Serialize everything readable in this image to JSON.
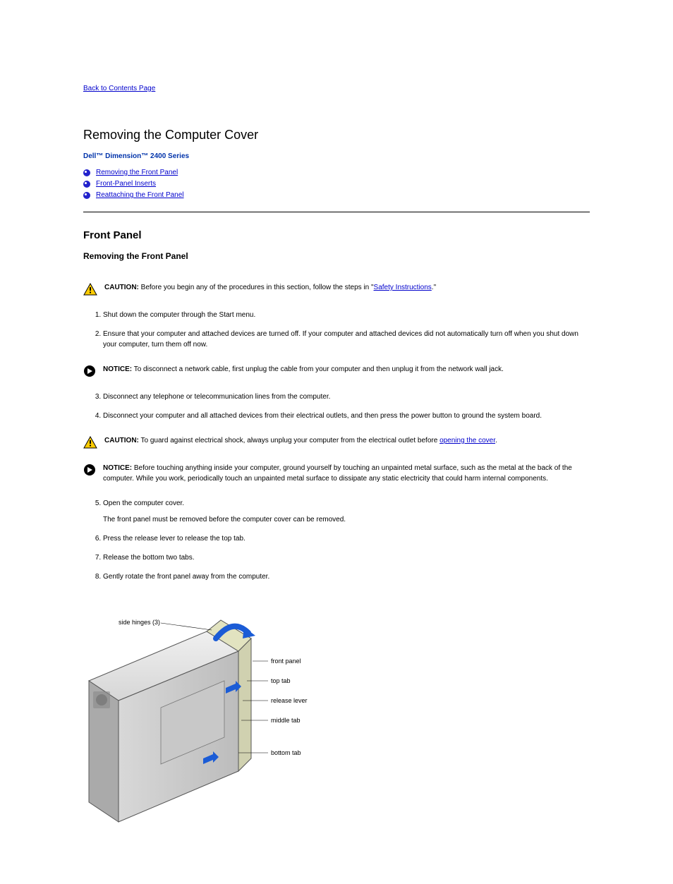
{
  "nav": {
    "back": "Back to Contents Page"
  },
  "header": {
    "title": "Removing the Computer Cover",
    "subtitle": "Dell™ Dimension™ 2400 Series"
  },
  "toc": [
    {
      "label": "Removing the Front Panel"
    },
    {
      "label": "Front-Panel Inserts"
    },
    {
      "label": "Reattaching the Front Panel"
    }
  ],
  "section": {
    "title": "Front Panel",
    "subsectionTitle": "Removing the Front Panel"
  },
  "callouts": {
    "caution1": {
      "label": "CAUTION:",
      "text": "Before you begin any of the procedures in this section, follow the steps in \"",
      "link": "Safety Instructions",
      "after": ".\""
    },
    "notice1": {
      "label": "NOTICE:",
      "text": "To disconnect a network cable, first unplug the cable from your computer and then unplug it from the network wall jack."
    },
    "caution2": {
      "label": "CAUTION:",
      "text": "To guard against electrical shock, always unplug your computer from the electrical outlet before ",
      "link": "opening the cover",
      "after": "."
    },
    "notice2": {
      "label": "NOTICE:",
      "text": "Before touching anything inside your computer, ground yourself by touching an unpainted metal surface, such as the metal at the back of the computer. While you work, periodically touch an unpainted metal surface to dissipate any static electricity that could harm internal components."
    }
  },
  "steps": [
    "Shut down the computer through the Start menu.",
    "Ensure that your computer and attached devices are turned off. If your computer and attached devices did not automatically turn off when you shut down your computer, turn them off now.",
    "Disconnect any telephone or telecommunication lines from the computer.",
    "Disconnect your computer and all attached devices from their electrical outlets, and then press the power button to ground the system board.",
    "Open the computer cover.",
    "Press the release lever to release the top tab.",
    "Release the bottom two tabs.",
    "Gently rotate the front panel away from the computer."
  ],
  "innerTexts": {
    "afterOpen": "The front panel must be removed before the computer cover can be removed."
  },
  "diagram": {
    "labels": {
      "sideHinges": "side hinges (3)",
      "frontPanel": "front panel",
      "topTab": "top tab",
      "releaseLever": "release lever",
      "middleTab": "middle tab",
      "bottomTab": "bottom tab"
    }
  }
}
